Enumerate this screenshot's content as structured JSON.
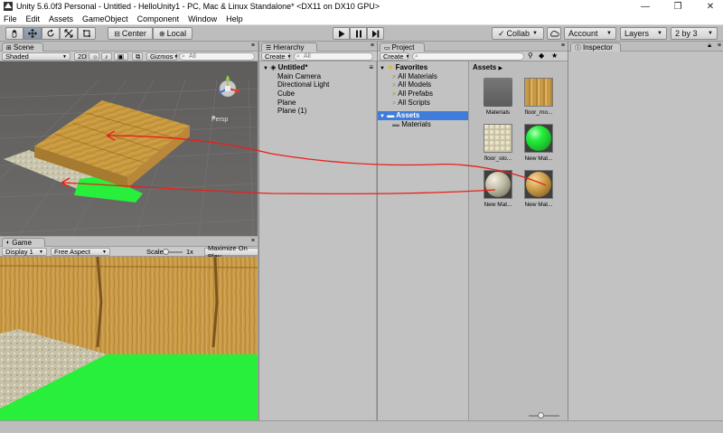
{
  "window": {
    "title": "Unity 5.6.0f3 Personal - Untitled - HelloUnity1 - PC, Mac & Linux Standalone* <DX11 on DX10 GPU>"
  },
  "menu": [
    "File",
    "Edit",
    "Assets",
    "GameObject",
    "Component",
    "Window",
    "Help"
  ],
  "toolbar": {
    "pivot_label": "Center",
    "space_label": "Local",
    "collab_label": "Collab",
    "account_label": "Account",
    "layers_label": "Layers",
    "layout_label": "2 by 3"
  },
  "scene": {
    "tab": "Scene",
    "shading": "Shaded",
    "mode_2d": "2D",
    "gizmos": "Gizmos",
    "search_placeholder": "All",
    "persp_label": "Persp"
  },
  "game": {
    "tab": "Game",
    "display": "Display 1",
    "aspect": "Free Aspect",
    "scale_label": "Scale",
    "scale_value": "1x",
    "maximize": "Maximize On Play"
  },
  "hierarchy": {
    "tab": "Hierarchy",
    "create": "Create",
    "search_placeholder": "All",
    "scene_name": "Untitled*",
    "items": [
      "Main Camera",
      "Directional Light",
      "Cube",
      "Plane",
      "Plane (1)"
    ]
  },
  "project": {
    "tab": "Project",
    "create": "Create",
    "favorites": {
      "label": "Favorites",
      "items": [
        "All Materials",
        "All Models",
        "All Prefabs",
        "All Scripts"
      ]
    },
    "assets_root": "Assets",
    "asset_folders": [
      "Materials"
    ],
    "breadcrumb": "Assets",
    "grid": [
      "Materials",
      "floor_mo...",
      "floor_sto...",
      "New Mat...",
      "New Mat...",
      "New Mat..."
    ]
  },
  "inspector": {
    "tab": "Inspector"
  },
  "colors": {
    "selection": "#3e7dd9",
    "annotation": "#e8201a",
    "bright_green": "#28ef3c"
  }
}
